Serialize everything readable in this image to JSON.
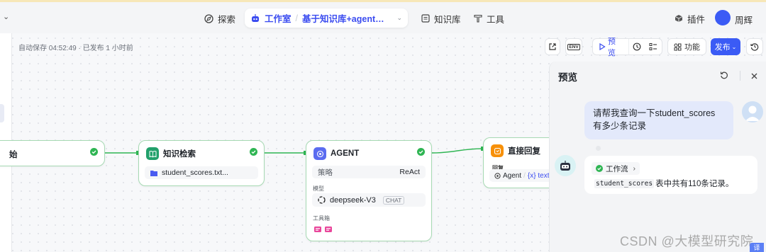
{
  "topnav": {
    "explore_label": "探索",
    "workspace_label": "工作室",
    "workflow_name": "基于知识库+agent实现te...",
    "knowledge_label": "知识库",
    "tools_label": "工具",
    "plugins_label": "插件",
    "username": "周辉"
  },
  "toolbar": {
    "autosave_text": "自动保存 04:52:49 · 已发布 1 小时前",
    "env_label": "ENV",
    "preview_label": "预览",
    "features_label": "功能",
    "publish_label": "发布"
  },
  "nodes": {
    "start": {
      "title_fragment": "始"
    },
    "knowledge": {
      "title": "知识检索",
      "file": "student_scores.txt..."
    },
    "agent": {
      "title": "AGENT",
      "strategy_label": "策略",
      "strategy_value": "ReAct",
      "model_label": "模型",
      "model_name": "deepseek-V3",
      "model_tag": "CHAT",
      "toolbox_label": "工具箱"
    },
    "reply": {
      "title": "直接回复",
      "reply_label": "回复",
      "ref_source": "Agent",
      "ref_sep": "/",
      "ref_var": "{x} text"
    }
  },
  "preview_panel": {
    "title": "预览",
    "user_message": "请帮我查询一下student_scores 有多少条记录",
    "workflow_tag": "工作流",
    "answer_code": "student_scores",
    "answer_text": "表中共有110条记录。"
  },
  "watermark": "CSDN @大模型研究院",
  "corner_badge": "译",
  "colors": {
    "brand": "#3b5bf5",
    "accent_blue": "#3b4cf0",
    "node_border": "#a6d9b3",
    "success": "#2fb553",
    "knowledge_icon": "#22a06b",
    "agent_icon": "#5b6cf0",
    "reply_icon": "#f79009"
  }
}
